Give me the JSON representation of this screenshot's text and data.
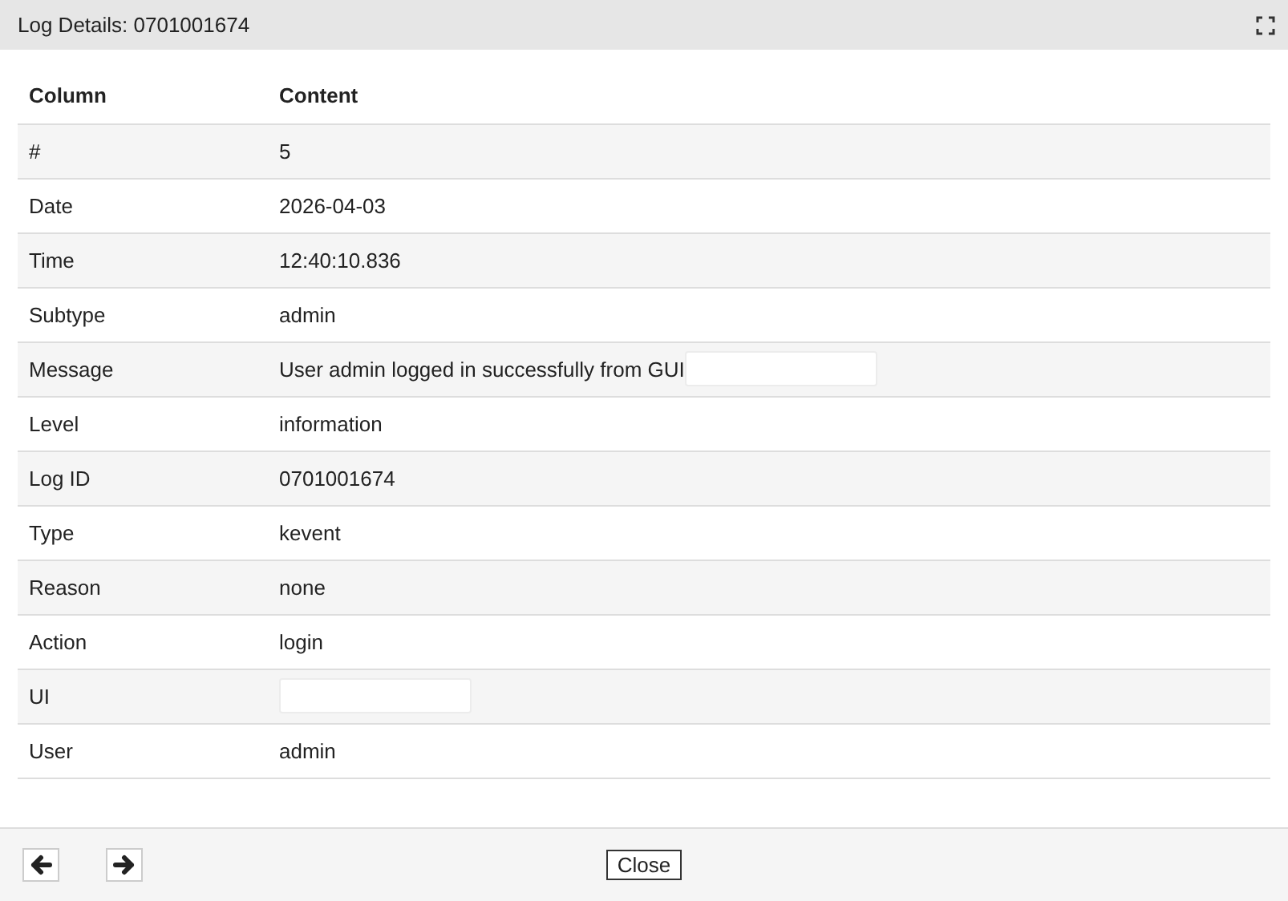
{
  "window": {
    "title": "Log Details: 0701001674"
  },
  "table": {
    "columns": [
      "Column",
      "Content"
    ],
    "rows": [
      {
        "kind": "plain",
        "label": "#",
        "value": "5"
      },
      {
        "kind": "plain",
        "label": "Date",
        "value": "2026-04-03"
      },
      {
        "kind": "plain",
        "label": "Time",
        "value": "12:40:10.836"
      },
      {
        "kind": "plain",
        "label": "Subtype",
        "value": "admin"
      },
      {
        "kind": "masked",
        "label": "Message",
        "value": "User admin logged in successfully from GUI"
      },
      {
        "kind": "plain",
        "label": "Level",
        "value": "information"
      },
      {
        "kind": "plain",
        "label": "Log ID",
        "value": "0701001674"
      },
      {
        "kind": "plain",
        "label": "Type",
        "value": "kevent"
      },
      {
        "kind": "plain",
        "label": "Reason",
        "value": "none"
      },
      {
        "kind": "plain",
        "label": "Action",
        "value": "login"
      },
      {
        "kind": "masked",
        "label": "UI"
      },
      {
        "kind": "plain",
        "label": "User",
        "value": "admin"
      }
    ]
  },
  "footer": {
    "close_button": "Close"
  }
}
